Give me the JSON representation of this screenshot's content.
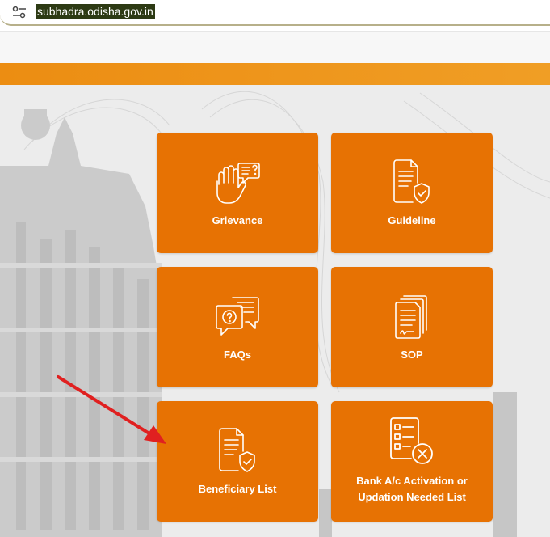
{
  "browser": {
    "url": "subhadra.odisha.gov.in",
    "site_settings_icon": "tune-icon"
  },
  "colors": {
    "card": "#e77203",
    "orange_bar": "#ec8d12",
    "arrow": "#e02020"
  },
  "cards": [
    {
      "label": "Grievance",
      "icon": "raised-hand-question-icon"
    },
    {
      "label": "Guideline",
      "icon": "document-shield-icon"
    },
    {
      "label": "FAQs",
      "icon": "faq-chat-bubbles-icon"
    },
    {
      "label": "SOP",
      "icon": "stacked-documents-icon"
    },
    {
      "label": "Beneficiary List",
      "icon": "document-check-shield-icon"
    },
    {
      "label": "Bank A/c Activation or Updation Needed List",
      "icon": "checklist-cancel-icon"
    }
  ]
}
